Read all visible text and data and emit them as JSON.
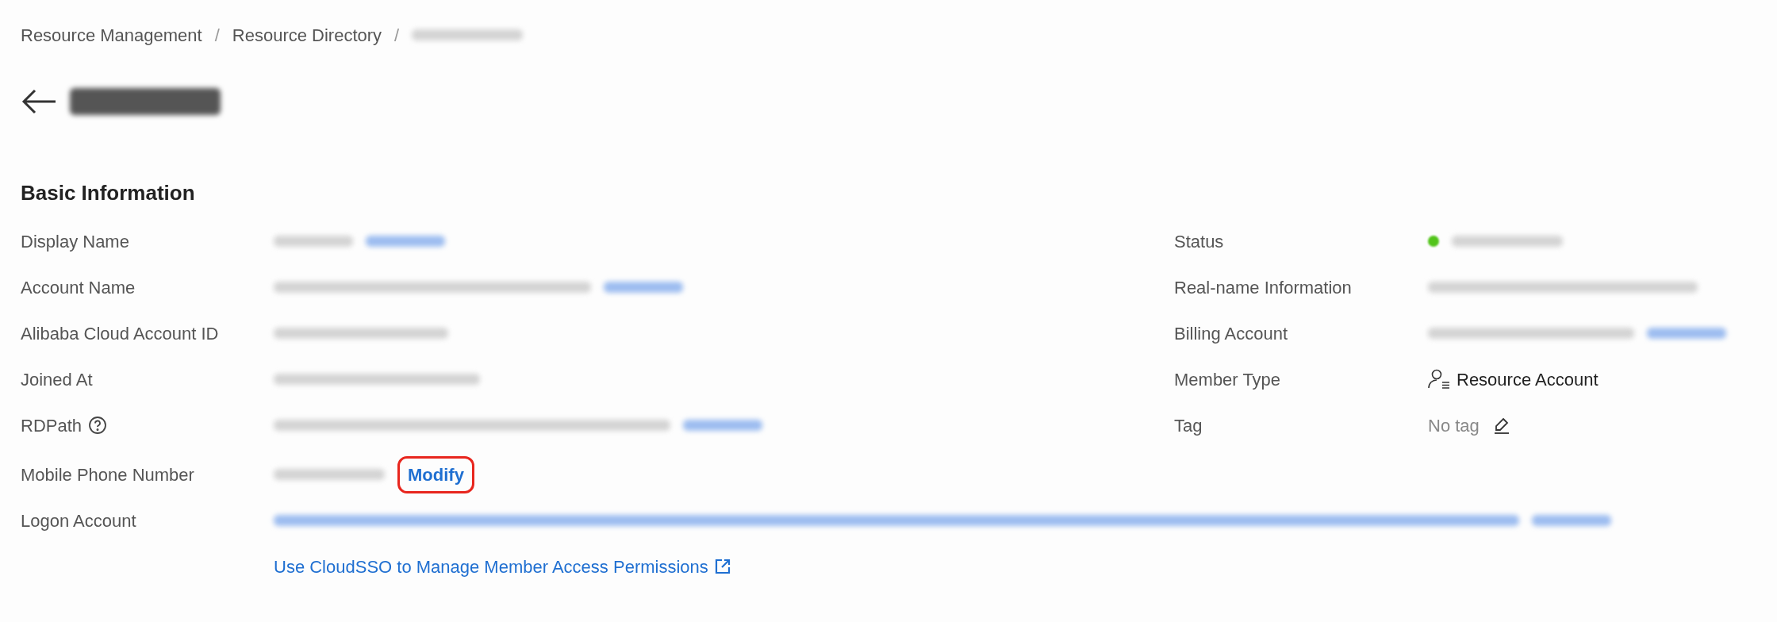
{
  "breadcrumb": [
    {
      "kind": "text",
      "text": "Resource Management"
    },
    {
      "kind": "separator",
      "text": "/"
    },
    {
      "kind": "text",
      "text": "Resource Directory"
    },
    {
      "kind": "separator",
      "text": "/"
    },
    {
      "kind": "redacted"
    }
  ],
  "section": {
    "title": "Basic Information"
  },
  "left_rows": [
    {
      "label": "Display Name",
      "parts": [
        {
          "kind": "redacted"
        },
        {
          "kind": "redacted-link"
        }
      ]
    },
    {
      "label": "Account Name",
      "parts": [
        {
          "kind": "redacted"
        },
        {
          "kind": "redacted-link"
        }
      ]
    },
    {
      "label": "Alibaba Cloud Account ID",
      "parts": [
        {
          "kind": "redacted"
        }
      ]
    },
    {
      "label": "Joined At",
      "parts": [
        {
          "kind": "redacted"
        }
      ]
    },
    {
      "label": "RDPath",
      "help": true,
      "parts": [
        {
          "kind": "redacted"
        },
        {
          "kind": "redacted-link"
        }
      ]
    }
  ],
  "right_rows": [
    {
      "label": "Status",
      "parts": [
        {
          "kind": "dot",
          "color": "#52c41a"
        },
        {
          "kind": "redacted"
        }
      ]
    },
    {
      "label": "Real-name Information",
      "parts": [
        {
          "kind": "redacted"
        }
      ]
    },
    {
      "label": "Billing Account",
      "parts": [
        {
          "kind": "redacted"
        },
        {
          "kind": "redacted-link"
        }
      ]
    },
    {
      "label": "Member Type",
      "parts": [
        {
          "kind": "member",
          "text": "Resource Account"
        }
      ]
    },
    {
      "label": "Tag",
      "parts": [
        {
          "kind": "muted",
          "text": "No tag"
        },
        {
          "kind": "edit"
        }
      ]
    }
  ],
  "bottom_rows": [
    {
      "label": "Mobile Phone Number",
      "parts": [
        {
          "kind": "redacted"
        },
        {
          "kind": "link",
          "text": "Modify",
          "highlighted": true
        }
      ]
    },
    {
      "label": "Logon Account",
      "parts": [
        {
          "kind": "redacted-link"
        },
        {
          "kind": "redacted-link"
        }
      ]
    },
    {
      "parts": [
        {
          "kind": "external-link",
          "text": "Use CloudSSO to Manage Member Access Permissions"
        }
      ]
    }
  ]
}
